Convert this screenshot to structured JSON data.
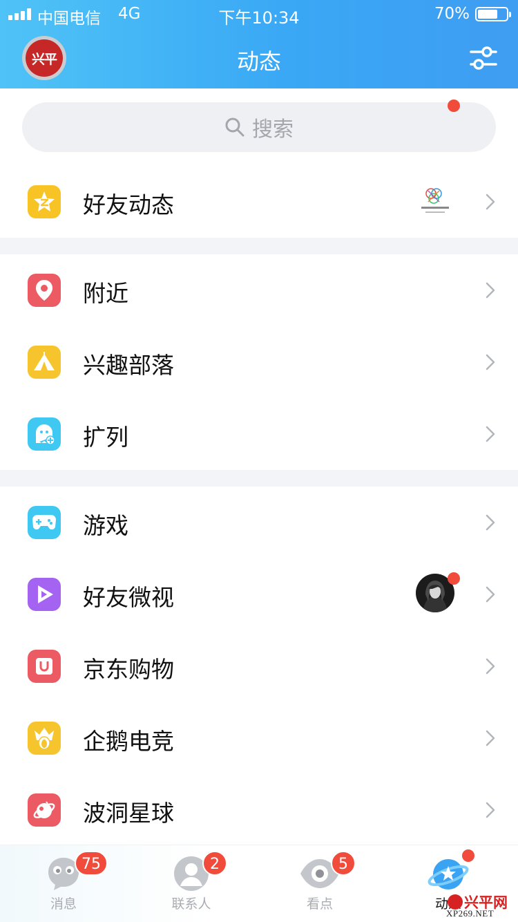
{
  "status_bar": {
    "carrier": "中国电信",
    "network": "4G",
    "time": "下午10:34",
    "battery": "70%",
    "battery_level": 0.7
  },
  "header": {
    "avatar_text": "兴平",
    "title": "动态"
  },
  "search": {
    "placeholder": "搜索"
  },
  "sections": [
    {
      "items": [
        {
          "label": "好友动态",
          "icon": "qzone-star-icon",
          "color": "#f7c325",
          "thumbnail": "logo-thumbnail",
          "red_dot": true
        }
      ]
    },
    {
      "items": [
        {
          "label": "附近",
          "icon": "location-pin-icon",
          "color": "#ec5b64"
        },
        {
          "label": "兴趣部落",
          "icon": "tent-icon",
          "color": "#f6c52d"
        },
        {
          "label": "扩列",
          "icon": "ghost-add-icon",
          "color": "#3ec8f2"
        }
      ]
    },
    {
      "items": [
        {
          "label": "游戏",
          "icon": "gamepad-icon",
          "color": "#3ec8f2"
        },
        {
          "label": "好友微视",
          "icon": "play-icon",
          "color": "#a463f0",
          "thumbnail": "avatar-thumbnail",
          "red_dot": true
        },
        {
          "label": "京东购物",
          "icon": "shopping-bag-icon",
          "color": "#ec5b64"
        },
        {
          "label": "企鹅电竞",
          "icon": "esports-crown-icon",
          "color": "#f6c52d"
        },
        {
          "label": "波洞星球",
          "icon": "planet-icon",
          "color": "#ec5b64"
        }
      ]
    }
  ],
  "tabbar": [
    {
      "label": "消息",
      "icon": "message-icon",
      "badge": "75"
    },
    {
      "label": "联系人",
      "icon": "contacts-icon",
      "badge": "2"
    },
    {
      "label": "看点",
      "icon": "eye-icon",
      "badge": "5"
    },
    {
      "label": "动态",
      "icon": "planet-star-icon",
      "red_dot": true,
      "active": true
    }
  ],
  "watermark": {
    "brand": "兴平网",
    "url": "XP269.NET"
  },
  "colors": {
    "header_start": "#4fc3f7",
    "header_end": "#3f9df2",
    "badge": "#f04b3b"
  }
}
